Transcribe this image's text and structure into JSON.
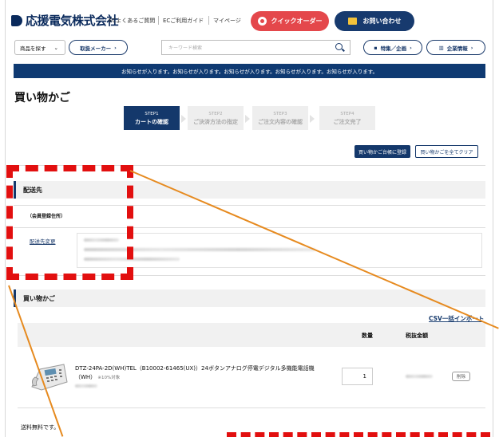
{
  "header": {
    "logo": "応援電気株式会社",
    "links": [
      "ECよくあるご質問",
      "ECご利用ガイド",
      "マイページ"
    ],
    "quick_order": "クイックオーダー",
    "contact": "お問い合わせ"
  },
  "searchbar": {
    "category_select": "商品を探す",
    "maker_button": "取扱メーカー",
    "placeholder": "キーワード検索",
    "feature_button": "特集／企画",
    "company_button": "企業情報"
  },
  "notice": "お知らせが入ります。お知らせが入ります。お知らせが入ります。お知らせが入ります。お知らせが入ります。",
  "page_title": "買い物かご",
  "steps": [
    {
      "num": "STEP1",
      "label": "カートの確認",
      "active": true
    },
    {
      "num": "STEP2",
      "label": "ご決済方法の指定",
      "active": false
    },
    {
      "num": "STEP3",
      "label": "ご注文内容の確認",
      "active": false
    },
    {
      "num": "STEP4",
      "label": "ご注文完了",
      "active": false
    }
  ],
  "actions": {
    "save": "買い物かご台帳に登録",
    "clear": "買い物かごを全てクリア"
  },
  "shipping_section": {
    "title": "配送先",
    "member_label": "（会員登録住所）",
    "change_link": "配送先変更"
  },
  "cart_section": {
    "title": "買い物かご",
    "csv_import": "CSV一括インポート",
    "columns": {
      "quantity": "数量",
      "price": "税抜金額"
    }
  },
  "cart_items": [
    {
      "name": "DTZ-24PA-2D(WH)TEL（B10002-61465(UX)）24ボタンアナログ停電デジタル多機能電話機（WH）",
      "tax": "※10%対象",
      "quantity": "1",
      "delete": "削除"
    }
  ],
  "footer_note": "送料無料です。",
  "colors": {
    "brand": "#14386b",
    "quick_order": "#e4474b",
    "annotation_red": "#e20f0f",
    "annotation_orange": "#e68a1f"
  }
}
